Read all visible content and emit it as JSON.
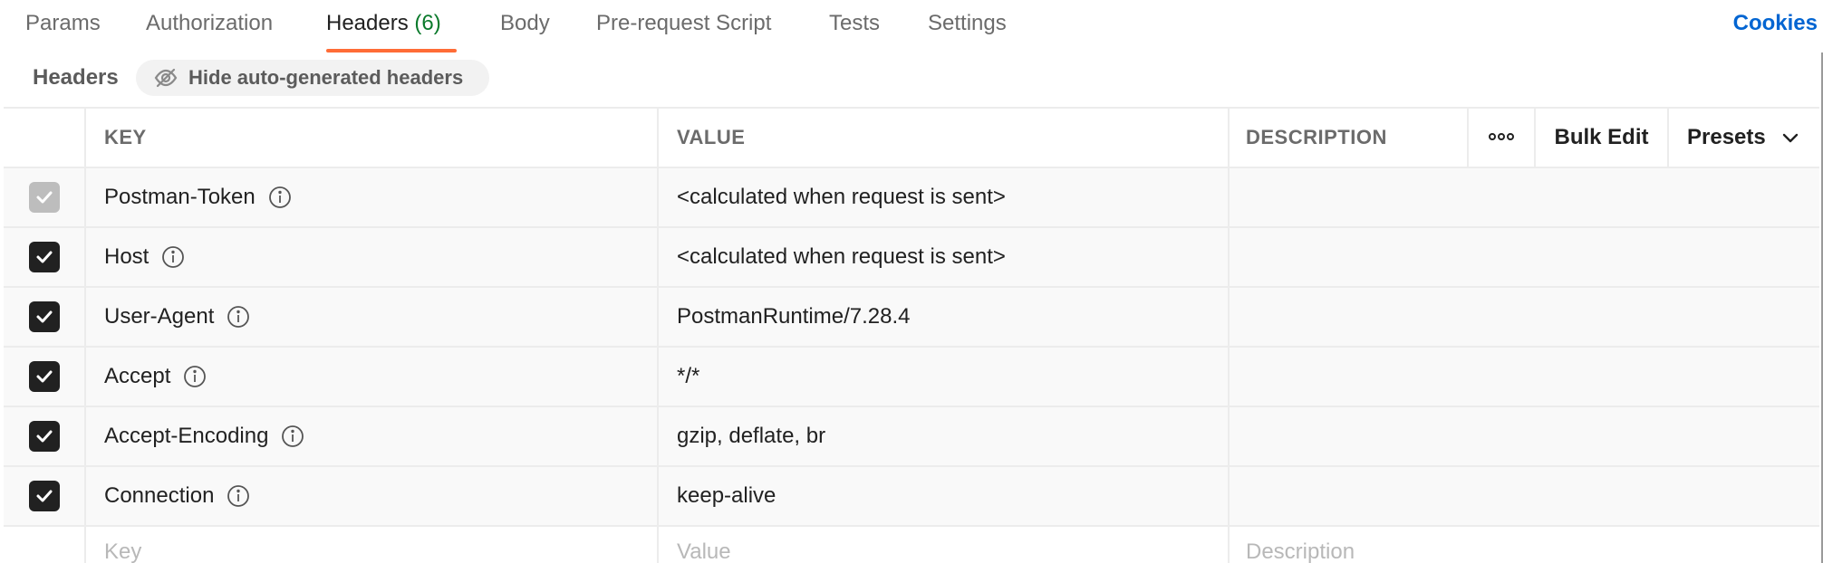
{
  "tabs": [
    {
      "label": "Params"
    },
    {
      "label": "Authorization"
    },
    {
      "label": "Headers",
      "count": "(6)"
    },
    {
      "label": "Body"
    },
    {
      "label": "Pre-request Script"
    },
    {
      "label": "Tests"
    },
    {
      "label": "Settings"
    }
  ],
  "cookies_label": "Cookies",
  "headers_section": {
    "title": "Headers",
    "toggle_label": "Hide auto-generated headers"
  },
  "table": {
    "columns": {
      "key": "KEY",
      "value": "VALUE",
      "description": "DESCRIPTION"
    },
    "bulk_edit_label": "Bulk Edit",
    "presets_label": "Presets",
    "rows": [
      {
        "key": "Postman-Token",
        "value": "<calculated when request is sent>",
        "checked": true,
        "disabled": true
      },
      {
        "key": "Host",
        "value": "<calculated when request is sent>",
        "checked": true,
        "disabled": false
      },
      {
        "key": "User-Agent",
        "value": "PostmanRuntime/7.28.4",
        "checked": true,
        "disabled": false
      },
      {
        "key": "Accept",
        "value": "*/*",
        "checked": true,
        "disabled": false
      },
      {
        "key": "Accept-Encoding",
        "value": "gzip, deflate, br",
        "checked": true,
        "disabled": false
      },
      {
        "key": "Connection",
        "value": "keep-alive",
        "checked": true,
        "disabled": false
      }
    ],
    "placeholders": {
      "key": "Key",
      "value": "Value",
      "description": "Description"
    }
  },
  "colors": {
    "accent_underline": "#ff6c37",
    "count_green": "#0b7a2c",
    "link_blue": "#0265d2"
  },
  "icons": {
    "toggle": "eye-off-icon",
    "info": "info-icon",
    "more": "more-horizontal-icon",
    "presets": "chevron-down-icon",
    "checkbox": "checkmark-icon"
  }
}
